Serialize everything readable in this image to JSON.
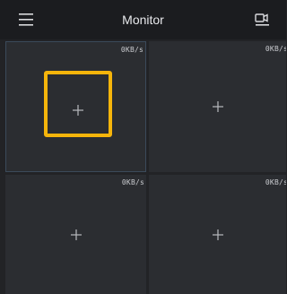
{
  "header": {
    "title": "Monitor",
    "menu_icon": "menu-icon",
    "camera_icon": "camera-icon"
  },
  "channels": [
    {
      "speed": "0KB/s",
      "icon": "add-icon"
    },
    {
      "speed": "0KB/s",
      "icon": "add-icon"
    },
    {
      "speed": "0KB/s",
      "icon": "add-icon"
    },
    {
      "speed": "0KB/s",
      "icon": "add-icon"
    }
  ],
  "colors": {
    "highlight": "#f6b50b",
    "background": "#222326",
    "cell": "#2b2d31",
    "text": "#e8e9ec"
  }
}
